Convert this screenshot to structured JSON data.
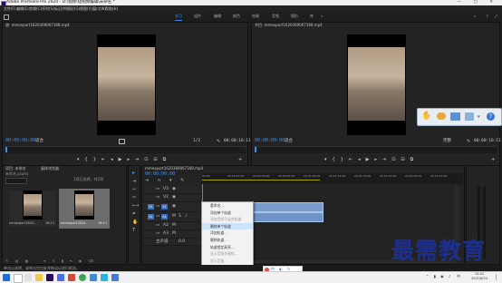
{
  "window": {
    "title": "Adobe Premiere Pro 2020 - D:\\视频\\短视频编辑\\未命名 *",
    "controls": [
      "—",
      "□",
      "✕"
    ]
  },
  "menubar": [
    "文件(F)",
    "编辑(E)",
    "剪辑(C)",
    "序列(S)",
    "标记(M)",
    "图形(G)",
    "视图(V)",
    "窗口(W)",
    "帮助(H)"
  ],
  "workspaces": [
    {
      "label": "学习",
      "active": true
    },
    {
      "label": "组件",
      "active": false
    },
    {
      "label": "编辑",
      "active": false
    },
    {
      "label": "颜色",
      "active": false
    },
    {
      "label": "效果",
      "active": false
    },
    {
      "label": "音频",
      "active": false
    },
    {
      "label": "图形",
      "active": false
    },
    {
      "label": "库",
      "active": false
    }
  ],
  "source_monitor": {
    "title": "源: mmexport1620369067168.mp4",
    "timecode": "00:00:00:00",
    "fit": "适合",
    "ratio": "1/2",
    "duration": "00:00:16:11"
  },
  "program_monitor": {
    "title": "节目: mmexport1620369067168.mp4",
    "timecode": "00:00:00:00",
    "fit": "适合",
    "ratio": "完整",
    "duration": "00:00:16:11"
  },
  "project_panel": {
    "tabs": [
      "项目: 未命名",
      "媒体浏览器"
    ],
    "path": "未命名.prproj",
    "item_count": "1项已选择，共2项",
    "items": [
      {
        "name": "mmexport1620...",
        "duration": "16:11"
      },
      {
        "name": "mmexport1620...",
        "duration": "16:11"
      }
    ]
  },
  "timeline": {
    "sequence_name": "mmexport1620369067168.mp4",
    "timecode": "00:00:00:00",
    "ruler_ticks": [
      "00:00",
      "00:00:15:00",
      "00:00:30:00",
      "00:00:45:00",
      "00:01:00:00",
      "00:01:15:00",
      "00:01:30:00",
      "00:01:45:00",
      "00:02:00:00",
      "00:02:15:00"
    ],
    "tracks": [
      "V3",
      "V2",
      "V1",
      "A1",
      "A2",
      "A3"
    ],
    "master": "主声道",
    "master_value": "0.0"
  },
  "context_menu": {
    "items": [
      {
        "label": "重命名...",
        "state": "normal"
      },
      {
        "label": "添加单个轨道",
        "state": "normal"
      },
      {
        "label": "添加音频子混合轨道",
        "state": "dim"
      },
      {
        "label": "删除单个轨道",
        "state": "highlight"
      },
      {
        "label": "添加轨道...",
        "state": "normal"
      },
      {
        "label": "删除轨道...",
        "state": "normal"
      },
      {
        "label": "轨道锁定高亮...",
        "state": "normal"
      },
      {
        "label": "显示音频关键帧...",
        "state": "dim"
      },
      {
        "label": "显示音量...",
        "state": "dim"
      },
      {
        "label": "自定义...",
        "state": "normal"
      }
    ]
  },
  "status_bar": {
    "text": "单击以选择，或单击空白处并拖动以进行框选。"
  },
  "watermark": "最需教育",
  "taskbar": {
    "time": "10:52",
    "date": "2021/6/24",
    "lang": "中"
  }
}
